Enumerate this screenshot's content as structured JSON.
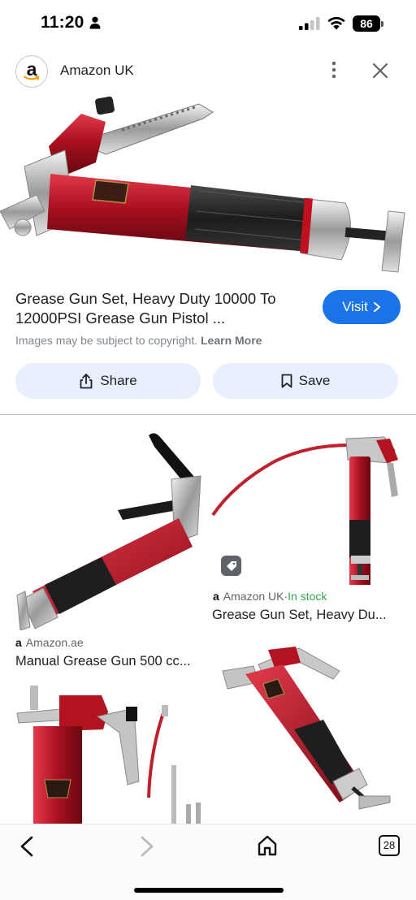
{
  "status_bar": {
    "time": "11:20",
    "battery": "86"
  },
  "header": {
    "logo_letter": "a",
    "site_name": "Amazon UK"
  },
  "result": {
    "title": "Grease Gun Set, Heavy Duty 10000 To 12000PSI Grease Gun Pistol ...",
    "visit_label": "Visit",
    "copyright_text": "Images may be subject to copyright.",
    "learn_more": "Learn More",
    "share_label": "Share",
    "save_label": "Save"
  },
  "grid": {
    "cards": [
      {
        "source": "Amazon.ae",
        "title": "Manual Grease Gun 500 cc..."
      },
      {
        "source": "Amazon UK",
        "stock": "In stock",
        "stock_separator": " · ",
        "title": "Grease Gun Set, Heavy Du..."
      }
    ]
  },
  "bottom_nav": {
    "tab_count": "28"
  },
  "colors": {
    "accent": "#1a73e8",
    "pill": "#e8f0fe",
    "in_stock": "#34a853",
    "gun_red": "#b3121f"
  }
}
